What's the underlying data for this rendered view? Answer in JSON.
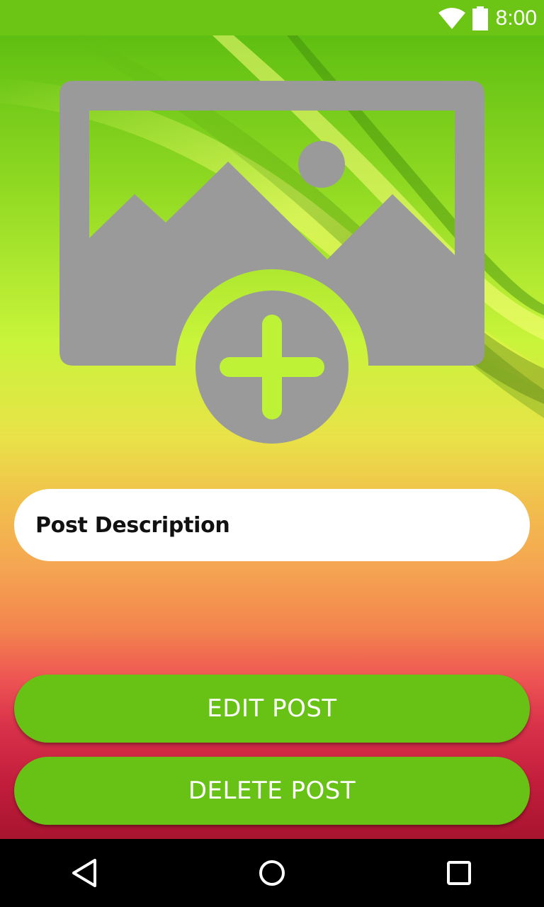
{
  "status_bar": {
    "time": "8:00",
    "icons": [
      "wifi-icon",
      "battery-icon"
    ],
    "color": "#6cc514"
  },
  "image_picker": {
    "icon": "add-photo-icon",
    "icon_color": "#9a9a9a"
  },
  "form": {
    "description_value": "Post Description"
  },
  "actions": {
    "edit_label": "EDIT POST",
    "delete_label": "DELETE POST",
    "button_color": "#68c216"
  },
  "nav_bar": {
    "buttons": [
      "back-icon",
      "home-icon",
      "recents-icon"
    ]
  }
}
